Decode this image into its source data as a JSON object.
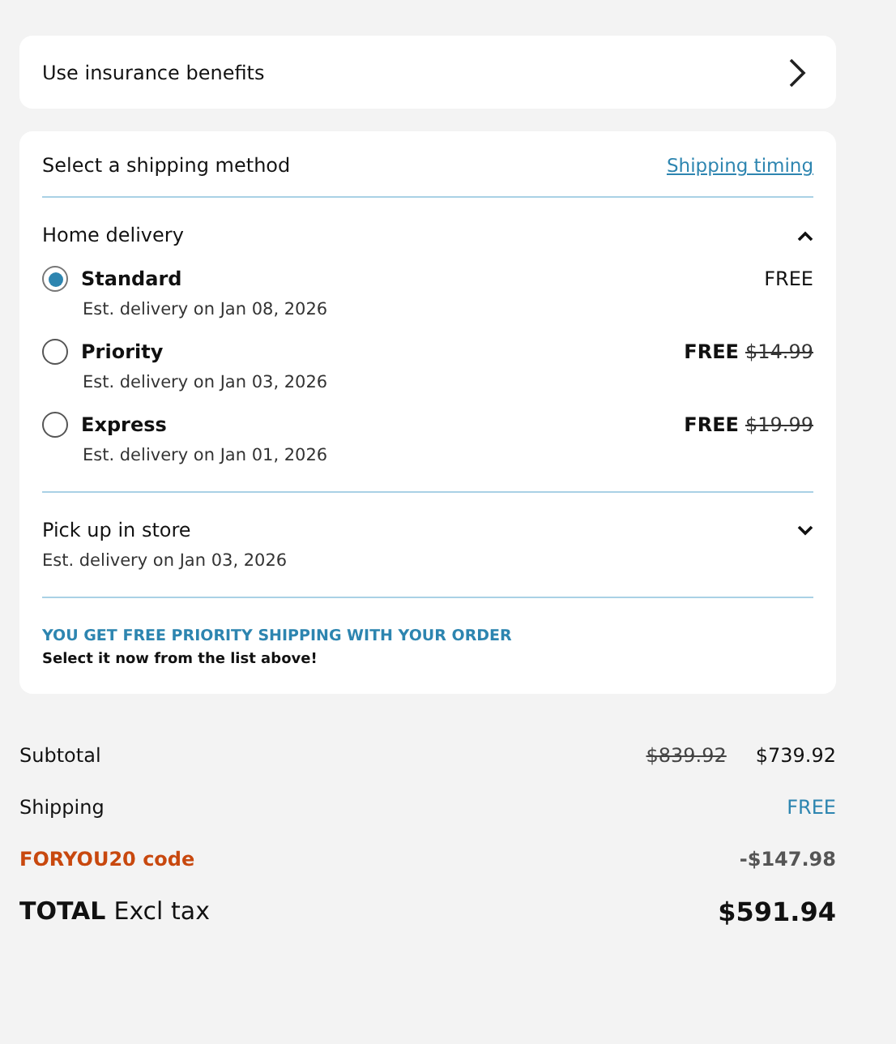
{
  "insurance": {
    "label": "Use insurance benefits"
  },
  "shipping": {
    "title": "Select a shipping method",
    "timing_link": "Shipping timing",
    "groups": [
      {
        "title": "Home delivery",
        "expanded": true,
        "options": [
          {
            "name": "Standard",
            "estimate": "Est. delivery on Jan 08, 2026",
            "price": "FREE",
            "selected": true
          },
          {
            "name": "Priority",
            "estimate": "Est. delivery on Jan 03, 2026",
            "price": "FREE",
            "old_price": "$14.99",
            "selected": false
          },
          {
            "name": "Express",
            "estimate": "Est. delivery on Jan 01, 2026",
            "price": "FREE",
            "old_price": "$19.99",
            "selected": false
          }
        ]
      },
      {
        "title": "Pick up in store",
        "expanded": false,
        "estimate": "Est. delivery on Jan 03, 2026"
      }
    ],
    "promo_title": "YOU GET FREE PRIORITY SHIPPING WITH YOUR ORDER",
    "promo_note": "Select it now from the list above!"
  },
  "summary": [
    {
      "kind": "subtotal",
      "label": "Subtotal",
      "old_value": "$839.92",
      "value": "$739.92"
    },
    {
      "kind": "shipping",
      "label": "Shipping",
      "value": "FREE"
    },
    {
      "kind": "discount",
      "label": "FORYOU20 code",
      "value": "-$147.98"
    },
    {
      "kind": "total",
      "label": "TOTAL",
      "note": "Excl tax",
      "value": "$591.94"
    }
  ]
}
